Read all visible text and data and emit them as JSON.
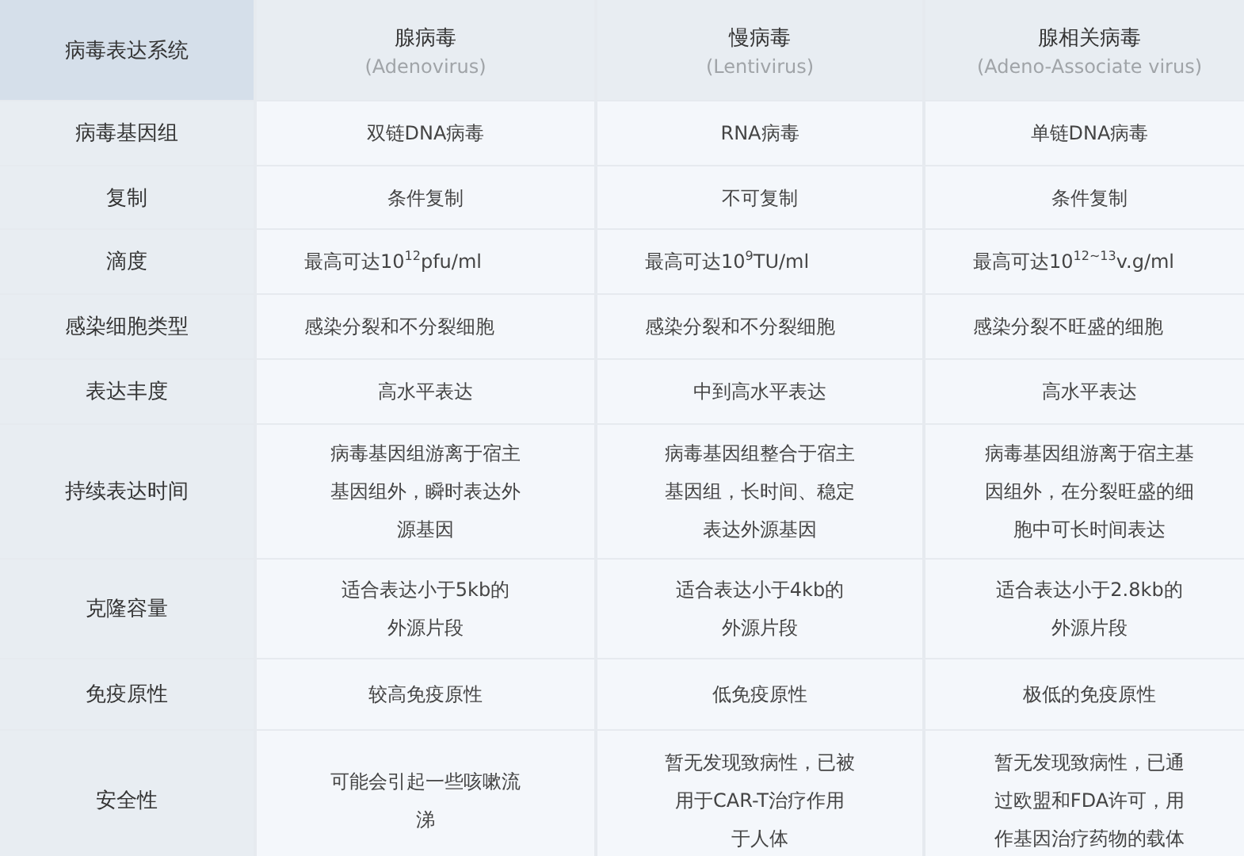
{
  "header": {
    "corner": "病毒表达系统",
    "columns": [
      {
        "name": "腺病毒",
        "latin": "(Adenovirus)"
      },
      {
        "name": "慢病毒",
        "latin": "(Lentivirus)"
      },
      {
        "name": "腺相关病毒",
        "latin": "(Adeno-Associate virus)"
      }
    ]
  },
  "rows": [
    {
      "label": "病毒基因组",
      "kind": "center",
      "cells": [
        [
          "双链DNA病毒"
        ],
        [
          "RNA病毒"
        ],
        [
          "单链DNA病毒"
        ]
      ]
    },
    {
      "label": "复制",
      "kind": "center",
      "cells": [
        [
          "条件复制"
        ],
        [
          "不可复制"
        ],
        [
          "条件复制"
        ]
      ]
    },
    {
      "label": "滴度",
      "kind": "left",
      "cells": [
        [
          "最高可达10$^{12}$pfu/ml"
        ],
        [
          "最高可达10$^{9}$TU/ml"
        ],
        [
          "最高可达10$^{12~13}$v.g/ml"
        ]
      ]
    },
    {
      "label": "感染细胞类型",
      "kind": "left",
      "cells": [
        [
          "感染分裂和不分裂细胞"
        ],
        [
          "感染分裂和不分裂细胞"
        ],
        [
          "感染分裂不旺盛的细胞"
        ]
      ]
    },
    {
      "label": "表达丰度",
      "kind": "center",
      "cells": [
        [
          "高水平表达"
        ],
        [
          "中到高水平表达"
        ],
        [
          "高水平表达"
        ]
      ]
    },
    {
      "label": "持续表达时间",
      "kind": "center",
      "cells": [
        [
          "病毒基因组游离于宿主",
          "基因组外，瞬时表达外",
          "源基因"
        ],
        [
          "病毒基因组整合于宿主",
          "基因组，长时间、稳定",
          "表达外源基因"
        ],
        [
          "病毒基因组游离于宿主基",
          "因组外，在分裂旺盛的细",
          "胞中可长时间表达"
        ]
      ]
    },
    {
      "label": "克隆容量",
      "kind": "center",
      "cells": [
        [
          "适合表达小于5kb的",
          "外源片段"
        ],
        [
          "适合表达小于4kb的",
          "外源片段"
        ],
        [
          "适合表达小于2.8kb的",
          "外源片段"
        ]
      ]
    },
    {
      "label": "免疫原性",
      "kind": "center",
      "cells": [
        [
          "较高免疫原性"
        ],
        [
          "低免疫原性"
        ],
        [
          "极低的免疫原性"
        ]
      ]
    },
    {
      "label": "安全性",
      "kind": "center",
      "cells": [
        [
          "可能会引起一些咳嗽流",
          "涕"
        ],
        [
          "暂无发现致病性，已被",
          "用于CAR-T治疗作用",
          "于人体"
        ],
        [
          "暂无发现致病性，已通",
          "过欧盟和FDA许可，用",
          "作基因治疗药物的载体"
        ]
      ]
    }
  ]
}
